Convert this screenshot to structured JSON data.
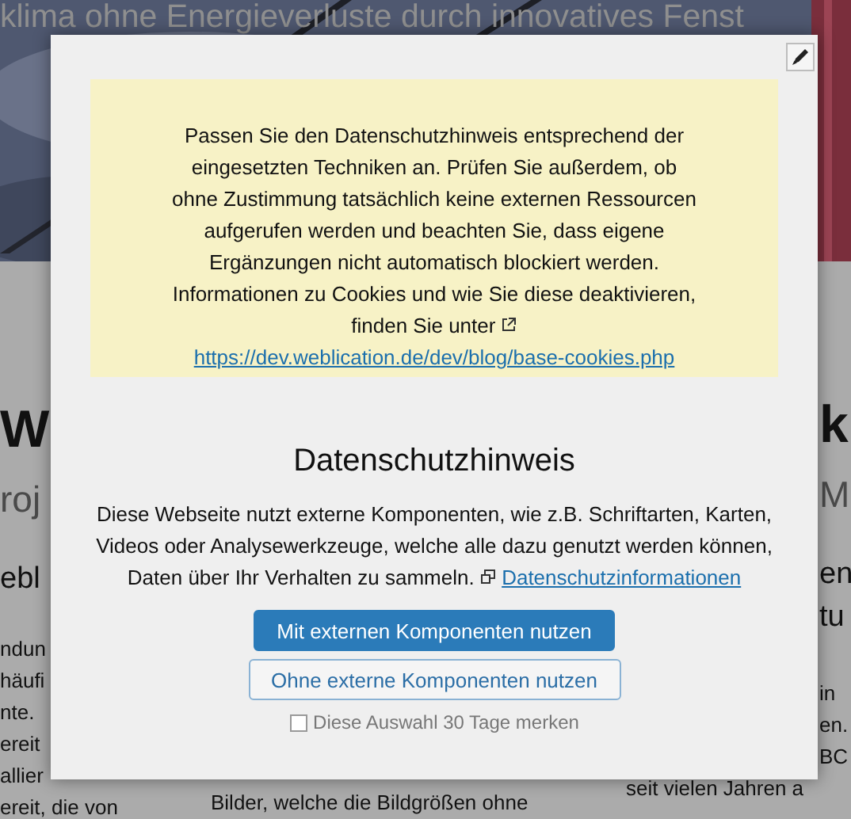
{
  "background_page": {
    "headline": "klima ohne Energieverluste durch innovatives Fenst",
    "left_fragments": [
      {
        "kind": "title",
        "text": "W"
      },
      {
        "kind": "subtitle",
        "text": "roj"
      },
      {
        "kind": "heading",
        "text": "ebl"
      },
      {
        "kind": "text",
        "text": "ndun"
      },
      {
        "kind": "text",
        "text": "häufi"
      },
      {
        "kind": "text",
        "text": "nte."
      },
      {
        "kind": "text",
        "text": "ereit"
      },
      {
        "kind": "text",
        "text": "allier"
      },
      {
        "kind": "text",
        "text": "ereit, die von"
      }
    ],
    "middle_fragments": [
      {
        "kind": "text",
        "text": "Bilder, welche die Bildgrößen ohne"
      }
    ],
    "right_fragments": [
      {
        "kind": "title",
        "text": "k",
        "below_dialog": false
      },
      {
        "kind": "subtitle",
        "text": "M",
        "below_dialog": false
      },
      {
        "kind": "heading",
        "text": "en",
        "below_dialog": false
      },
      {
        "kind": "heading",
        "text": "tu",
        "below_dialog": false
      },
      {
        "kind": "text",
        "text": "in",
        "below_dialog": false
      },
      {
        "kind": "text",
        "text": "en.",
        "below_dialog": false
      },
      {
        "kind": "text",
        "text": "BC",
        "below_dialog": false
      },
      {
        "kind": "text",
        "text": "seit vielen Jahren a",
        "below_dialog": true
      }
    ]
  },
  "dialog": {
    "notice": "Passen Sie den Datenschutzhinweis entsprechend der eingesetzten Techniken an. Prüfen Sie außerdem, ob ohne Zustimmung tatsächlich keine externen Ressourcen aufgerufen werden und beachten Sie, dass eigene Ergänzungen nicht automatisch blockiert werden. Informationen zu Cookies und wie Sie diese deaktivieren, finden Sie unter",
    "notice_link": "https://dev.weblication.de/dev/blog/base-cookies.php",
    "title": "Datenschutzhinweis",
    "text": "Diese Webseite nutzt externe Komponenten, wie z.B. Schriftarten, Karten, Videos oder Analysewerkzeuge, welche alle dazu genutzt werden können, Daten über Ihr Verhalten zu sammeln.",
    "text_link": "Datenschutzinformationen",
    "buttons": [
      {
        "label": "Mit externen Komponenten nutzen",
        "kind": "primary"
      },
      {
        "label": "Ohne externe Komponenten nutzen",
        "kind": "secondary"
      }
    ],
    "remember": {
      "label": "Diese Auswahl 30 Tage merken",
      "checked": false
    }
  }
}
